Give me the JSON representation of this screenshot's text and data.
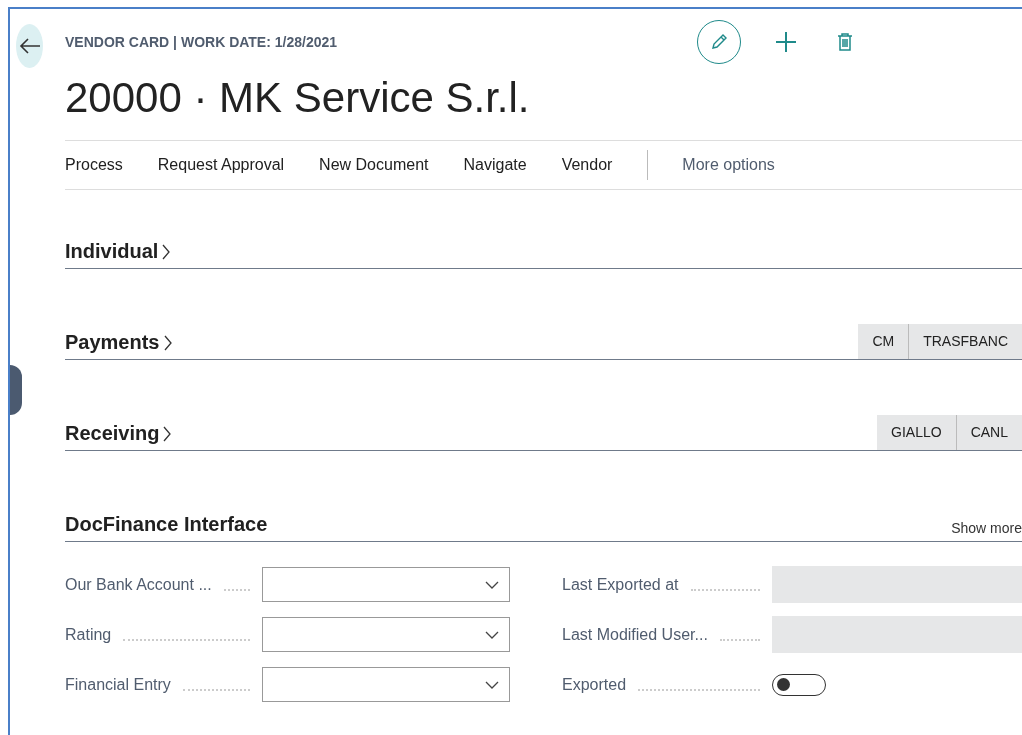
{
  "header": {
    "caption": "VENDOR CARD | WORK DATE: 1/28/2021",
    "title": "20000 · MK Service S.r.l."
  },
  "action_bar": {
    "items": [
      "Process",
      "Request Approval",
      "New Document",
      "Navigate",
      "Vendor"
    ],
    "more": "More options"
  },
  "fasttabs": [
    {
      "title": "Individual",
      "expanded": false
    },
    {
      "title": "Payments",
      "expanded": false,
      "tags": [
        "CM",
        "TRASFBANC"
      ]
    },
    {
      "title": "Receiving",
      "expanded": false,
      "tags": [
        "GIALLO",
        "CANL"
      ]
    }
  ],
  "docfinance": {
    "title": "DocFinance Interface",
    "show_more": "Show more",
    "left_fields": [
      {
        "label": "Our Bank Account ...",
        "kind": "dropdown"
      },
      {
        "label": "Rating",
        "kind": "dropdown"
      },
      {
        "label": "Financial Entry",
        "kind": "dropdown"
      }
    ],
    "right_fields": [
      {
        "label": "Last Exported at",
        "kind": "readonly"
      },
      {
        "label": "Last Modified User...",
        "kind": "readonly"
      },
      {
        "label": "Exported",
        "kind": "toggle",
        "on": false
      }
    ]
  }
}
